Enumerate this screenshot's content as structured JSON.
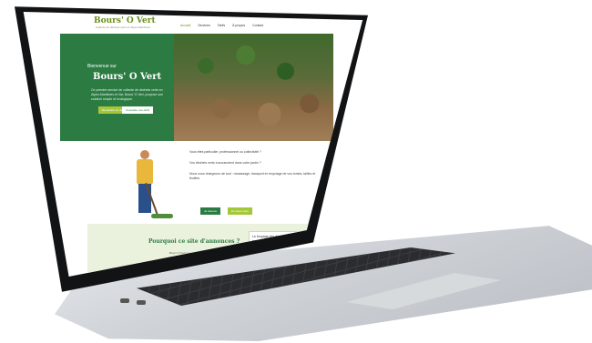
{
  "site": {
    "logo": "Bours' O Vert",
    "tagline": "Collecte de déchets verts en Alpes-Maritimes",
    "nav": [
      "Accueil",
      "Services",
      "Tarifs",
      "À propos",
      "Contact"
    ]
  },
  "hero": {
    "welcome": "Bienvenue sur",
    "title": "Bours' O Vert",
    "description": "Ce premier service de collecte de déchets verts en Alpes-Maritimes et Var, Bours' O Vert, propose une solution simple et écologique.",
    "buttons": [
      "Demander un devis",
      "Connaître nos tarifs"
    ]
  },
  "intro": {
    "paragraphs": [
      "Vous êtes particulier, professionnel ou collectivité ?",
      "Vos déchets verts s'accumulent dans votre jardin ?",
      "Nous nous chargeons de tout : ramassage, transport et recyclage de vos tontes, tailles et feuilles."
    ],
    "buttons": [
      "Je réserve",
      "En savoir plus"
    ]
  },
  "why": {
    "title": "Pourquoi ce site d'annonces ?",
    "text": "Bours' O Vert met en relation particuliers et professionnels pour faciliter la collecte et la valorisation des déchets verts."
  },
  "card": {
    "text": "Le broyage des déchets verts a un impact positif sur l'environnement",
    "button": ""
  },
  "colors": {
    "brand": "#2b7b43",
    "accent": "#a4c639",
    "logo": "#6b8f1c"
  }
}
